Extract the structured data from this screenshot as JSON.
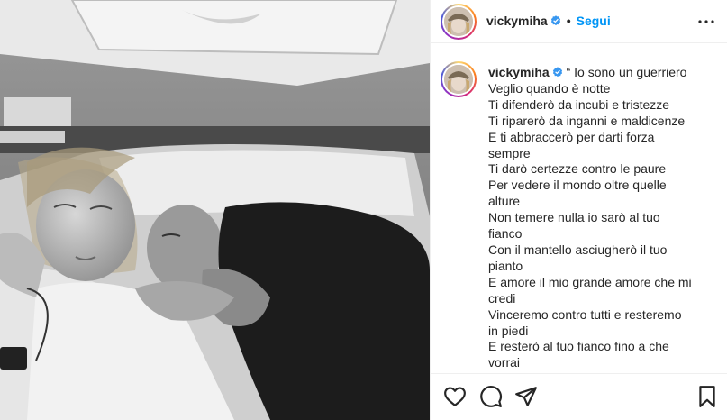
{
  "post": {
    "username": "vickymiha",
    "follow_label": "Segui",
    "dot": "•",
    "caption_lines": [
      "“ Io sono un guerriero",
      "Veglio quando è notte",
      "Ti difenderò da incubi e tristezze",
      "Ti riparerò da inganni e maldicenze",
      "E ti abbraccerò per darti forza",
      "sempre",
      "Ti darò certezze contro le paure",
      "Per vedere il mondo oltre quelle",
      "alture",
      "Non temere nulla io sarò al tuo",
      "fianco",
      "Con il mantello asciugherò il tuo",
      "pianto",
      "E amore il mio grande amore che mi",
      "credi",
      "Vinceremo contro tutti e resteremo",
      "in piedi",
      "E resterò al tuo fianco fino a che",
      "vorrai"
    ]
  },
  "icons": {
    "verified": "verified-badge-icon",
    "more": "more-options-icon",
    "like": "heart-icon",
    "comment": "comment-icon",
    "share": "paper-plane-icon",
    "save": "bookmark-icon"
  },
  "colors": {
    "accent": "#0095f6",
    "text": "#262626",
    "border": "#efefef"
  }
}
